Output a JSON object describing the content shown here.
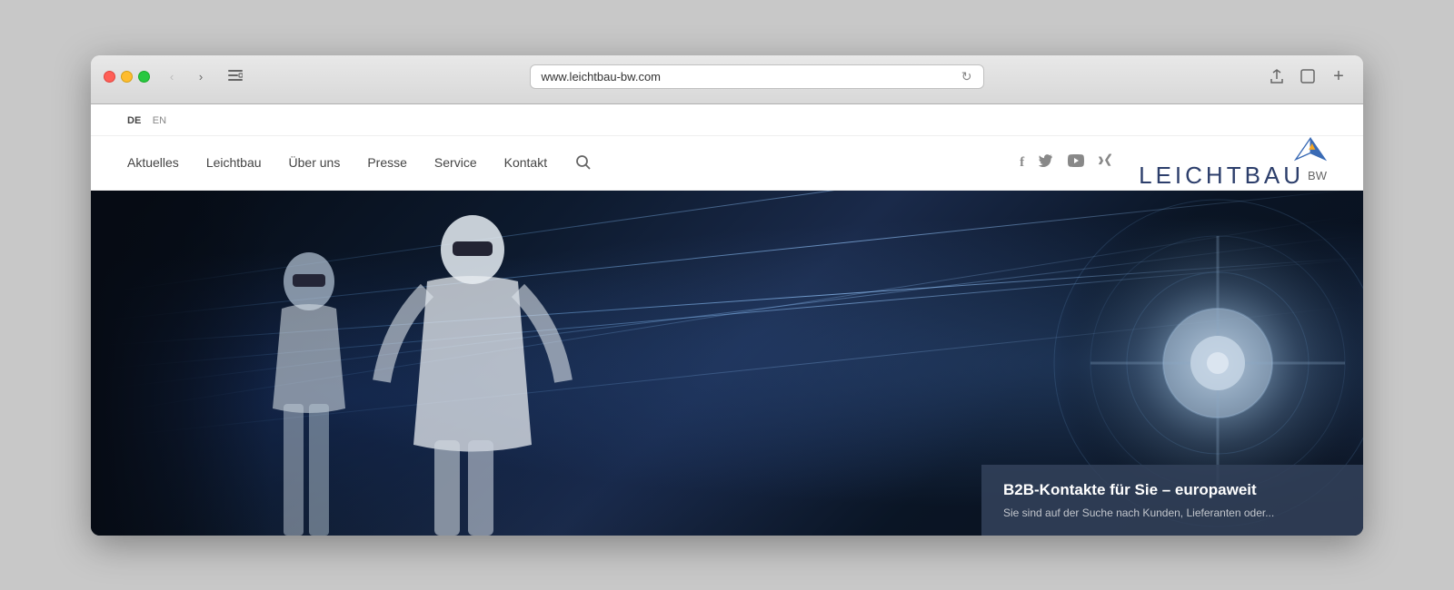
{
  "browser": {
    "url": "www.leichtbau-bw.com",
    "reload_icon": "↻"
  },
  "lang_bar": {
    "de": "DE",
    "en": "EN"
  },
  "nav": {
    "links": [
      {
        "id": "aktuelles",
        "label": "Aktuelles"
      },
      {
        "id": "leichtbau",
        "label": "Leichtbau"
      },
      {
        "id": "ueber-uns",
        "label": "Über uns"
      },
      {
        "id": "presse",
        "label": "Presse"
      },
      {
        "id": "service",
        "label": "Service"
      },
      {
        "id": "kontakt",
        "label": "Kontakt"
      }
    ],
    "social": [
      {
        "id": "facebook",
        "label": "f"
      },
      {
        "id": "twitter",
        "label": "𝕏"
      },
      {
        "id": "youtube",
        "label": "▶"
      },
      {
        "id": "xing",
        "label": "𝕏"
      }
    ]
  },
  "logo": {
    "text": "LEICHTBAU",
    "suffix": "BW"
  },
  "hero": {
    "bottom_title": "B2B-Kontakte für Sie – europaweit",
    "bottom_subtitle": "Sie sind auf der Suche nach Kunden, Lieferanten oder..."
  }
}
